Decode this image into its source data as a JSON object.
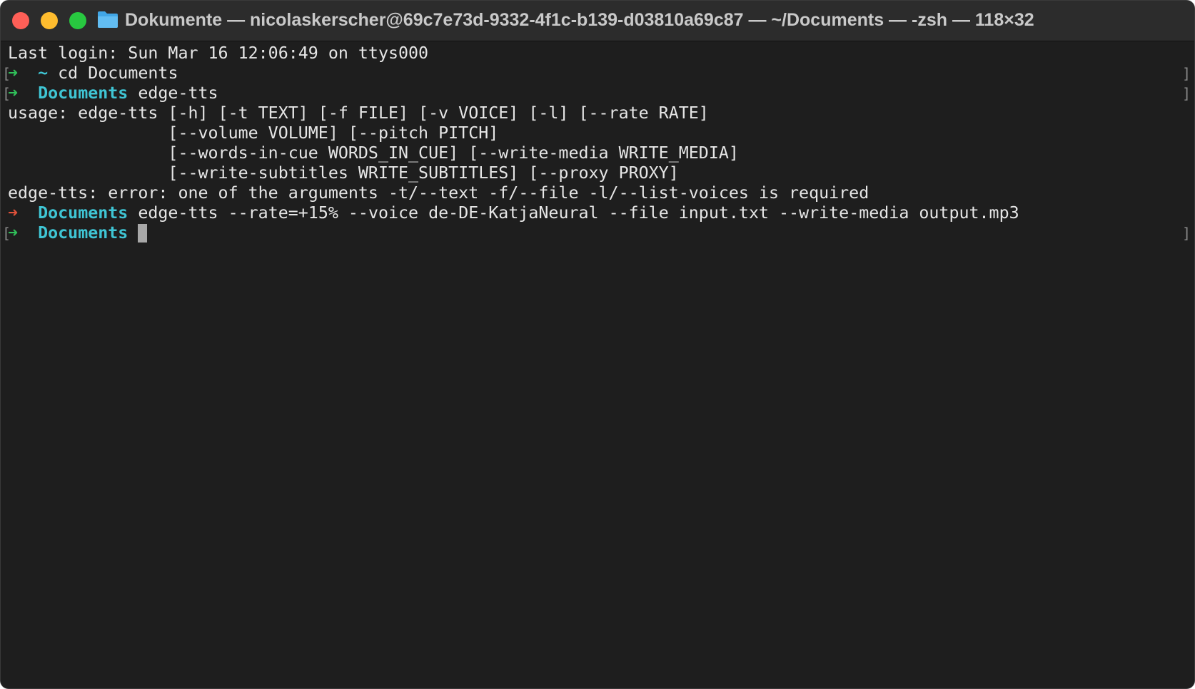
{
  "window": {
    "title": "Dokumente — nicolaskerscher@69c7e73d-9332-4f1c-b139-d03810a69c87 — ~/Documents — -zsh — 118×32",
    "folder_icon": "folder-icon",
    "colors": {
      "close": "#fe5f57",
      "minimize": "#febc2e",
      "zoom": "#28c840",
      "prompt_arrow_ok": "#30c05a",
      "prompt_arrow_error": "#e0513a",
      "directory": "#3fc5d4",
      "background": "#1e1e1e"
    }
  },
  "terminal": {
    "last_login": "Last login: Sun Mar 16 12:06:49 on ttys000",
    "prompt_arrow": "➜",
    "cmd1": {
      "dir": "~",
      "command": "cd Documents"
    },
    "cmd2": {
      "dir": "Documents",
      "command": "edge-tts"
    },
    "usage": [
      "usage: edge-tts [-h] [-t TEXT] [-f FILE] [-v VOICE] [-l] [--rate RATE]",
      "                [--volume VOLUME] [--pitch PITCH]",
      "                [--words-in-cue WORDS_IN_CUE] [--write-media WRITE_MEDIA]",
      "                [--write-subtitles WRITE_SUBTITLES] [--proxy PROXY]"
    ],
    "error": "edge-tts: error: one of the arguments -t/--text -f/--file -l/--list-voices is required",
    "cmd3": {
      "dir": "Documents",
      "command": "edge-tts --rate=+15% --voice de-DE-KatjaNeural --file input.txt --write-media output.mp3"
    },
    "cmd4": {
      "dir": "Documents",
      "command": ""
    },
    "mark_left": "[",
    "mark_right": "]"
  }
}
